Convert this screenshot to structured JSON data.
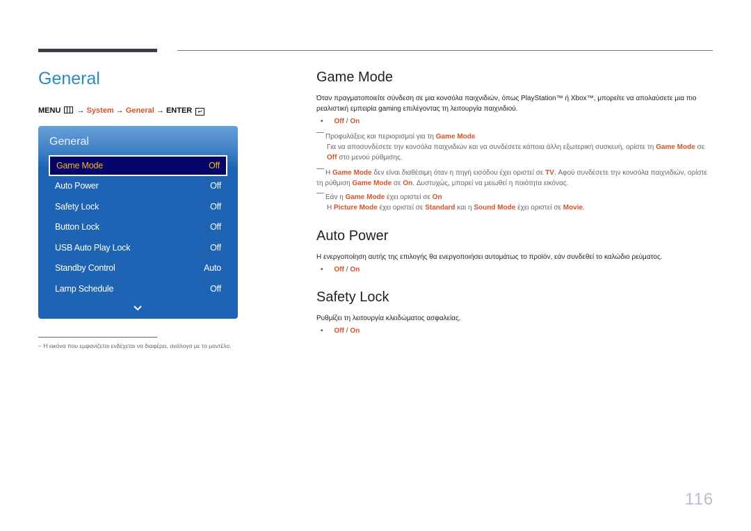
{
  "section_title": "General",
  "breadcrumb": {
    "menu": "MENU",
    "arrow": "→",
    "system": "System",
    "general": "General",
    "enter": "ENTER",
    "enter_glyph": "↵"
  },
  "osd": {
    "title": "General",
    "items": [
      {
        "label": "Game Mode",
        "value": "Off",
        "selected": true
      },
      {
        "label": "Auto Power",
        "value": "Off"
      },
      {
        "label": "Safety Lock",
        "value": "Off"
      },
      {
        "label": "Button Lock",
        "value": "Off"
      },
      {
        "label": "USB Auto Play Lock",
        "value": "Off"
      },
      {
        "label": "Standby Control",
        "value": "Auto"
      },
      {
        "label": "Lamp Schedule",
        "value": "Off"
      }
    ],
    "colors": {
      "selected_bg": "#04046b",
      "selected_text": "#f5b81e",
      "panel": "#1f64b4"
    }
  },
  "footnote": "− Η εικόνα που εμφανίζεται ενδέχεται να διαφέρει, ανάλογα με το μοντέλο.",
  "game_mode": {
    "title": "Game Mode",
    "description": "Όταν πραγματοποιείτε σύνδεση σε μια κονσόλα παιχνιδιών, όπως PlayStation™ ή Xbox™, μπορείτε να απολαύσετε μια πιο ρεαλιστική εμπειρία gaming επιλέγοντας τη λειτουργία παιχνιδιού.",
    "options": {
      "off": "Off",
      "sep": "/",
      "on": "On"
    },
    "note1": {
      "title_pre": "Προφυλάξεις και περιορισμοί για τη ",
      "title_hl": "Game Mode",
      "body_pre": "Για να αποσυνδέσετε την κονσόλα παιχνιδιών και να συνδέσετε κάποια άλλη εξωτερική συσκευή, ορίστε τη ",
      "body_hl1": "Game Mode",
      "body_mid": " σε ",
      "body_hl2": "Off",
      "body_post": " στο μενού ρύθμισης."
    },
    "note2": {
      "p1": "Η ",
      "hl1": "Game Mode",
      "p2": " δεν είναι διαθέσιμη όταν η πηγή εισόδου έχει οριστεί σε ",
      "hl2": "TV",
      "p3": ". Αφού συνδέσετε την κονσόλα παιχνιδιών, ορίστε τη ρύθμιση ",
      "hl3": "Game Mode",
      "p4": " σε ",
      "hl4": "On",
      "p5": ". Δυστυχώς, μπορεί να μειωθεί η ποιότητα εικόνας."
    },
    "note3": {
      "p1": "Εάν η ",
      "hl1": "Game Mode",
      "p2": " έχει οριστεί σε ",
      "hl2": "On",
      "b1": "Η ",
      "bhl1": "Picture Mode",
      "b2": " έχει οριστεί σε ",
      "bhl2": "Standard",
      "b3": " και η ",
      "bhl3": "Sound Mode",
      "b4": " έχει οριστεί σε ",
      "bhl4": "Movie",
      "b5": "."
    }
  },
  "auto_power": {
    "title": "Auto Power",
    "description": "Η ενεργοποίηση αυτής της επιλογής θα ενεργοποιήσει αυτομάτως το προϊόν, εάν συνδεθεί το καλώδιο ρεύματος.",
    "options": {
      "off": "Off",
      "sep": "/",
      "on": "On"
    }
  },
  "safety_lock": {
    "title": "Safety Lock",
    "description": "Ρυθμίζει τη λειτουργία κλειδώματος ασφαλείας.",
    "options": {
      "off": "Off",
      "sep": "/",
      "on": "On"
    }
  },
  "page_number": "116",
  "accent_color": "#d2542a",
  "title_color": "#2a8ac9"
}
